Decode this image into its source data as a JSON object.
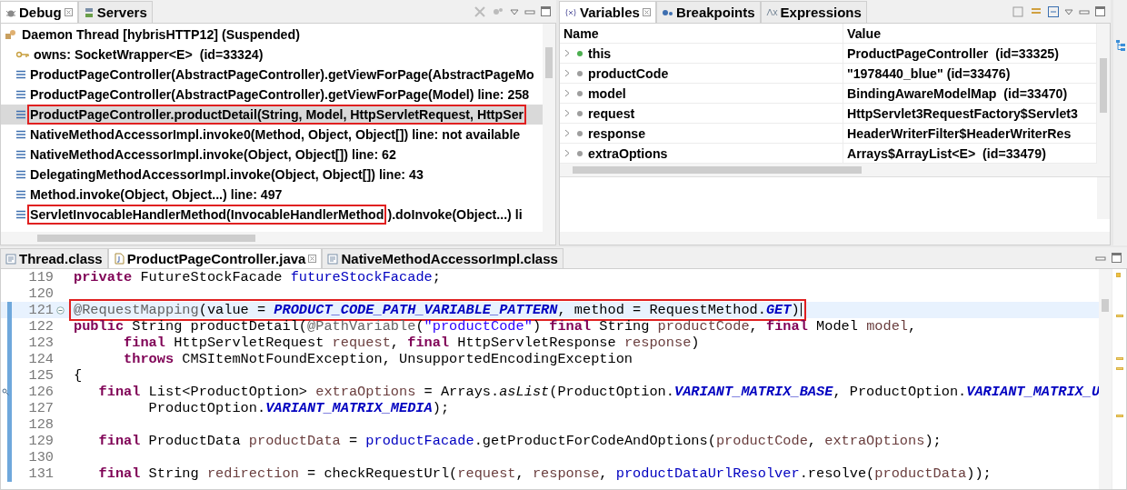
{
  "debug_view": {
    "tabs": [
      {
        "label": "Debug",
        "kind": "debug",
        "selected": true
      },
      {
        "label": "Servers",
        "kind": "servers",
        "selected": false
      }
    ],
    "thread": {
      "label": "Daemon Thread [hybrisHTTP12] (Suspended)",
      "kind": "thread",
      "children": [
        {
          "kind": "monitor",
          "text": "owns: SocketWrapper<E>  (id=33324)",
          "selected": false
        },
        {
          "kind": "frame",
          "text": "ProductPageController(AbstractPageController).getViewForPage(AbstractPageMo",
          "selected": false
        },
        {
          "kind": "frame",
          "text": "ProductPageController(AbstractPageController).getViewForPage(Model) line: 258",
          "selected": false
        },
        {
          "kind": "frame",
          "text": "ProductPageController.productDetail(String, Model, HttpServletRequest, HttpSer",
          "selected": true,
          "outlined": true
        },
        {
          "kind": "frame",
          "text": "NativeMethodAccessorImpl.invoke0(Method, Object, Object[]) line: not available",
          "selected": false
        },
        {
          "kind": "frame",
          "text": "NativeMethodAccessorImpl.invoke(Object, Object[]) line: 62",
          "selected": false
        },
        {
          "kind": "frame",
          "text": "DelegatingMethodAccessorImpl.invoke(Object, Object[]) line: 43",
          "selected": false
        },
        {
          "kind": "frame",
          "text": "Method.invoke(Object, Object...) line: 497",
          "selected": false
        },
        {
          "kind": "frame",
          "text": "ServletInvocableHandlerMethod(InvocableHandlerMethod",
          "continuation": ").doInvoke(Object...) li",
          "selected": false,
          "outlined": true
        }
      ]
    }
  },
  "variables_view": {
    "tabs": [
      {
        "label": "Variables",
        "kind": "variables",
        "selected": true
      },
      {
        "label": "Breakpoints",
        "kind": "breakpoints",
        "selected": false
      },
      {
        "label": "Expressions",
        "kind": "expressions",
        "selected": false
      }
    ],
    "columns": [
      "Name",
      "Value"
    ],
    "rows": [
      {
        "name": "this",
        "value": "ProductPageController  (id=33325)",
        "color": "#4caf50",
        "expanded": false
      },
      {
        "name": "productCode",
        "value": "\"1978440_blue\" (id=33476)",
        "color": "#9e9e9e",
        "expanded": false
      },
      {
        "name": "model",
        "value": "BindingAwareModelMap  (id=33470)",
        "color": "#9e9e9e",
        "expanded": false
      },
      {
        "name": "request",
        "value": "HttpServlet3RequestFactory$Servlet3",
        "color": "#9e9e9e",
        "expanded": false
      },
      {
        "name": "response",
        "value": "HeaderWriterFilter$HeaderWriterRes",
        "color": "#9e9e9e",
        "expanded": false
      },
      {
        "name": "extraOptions",
        "value": "Arrays$ArrayList<E>  (id=33479)",
        "color": "#9e9e9e",
        "expanded": false
      }
    ]
  },
  "editor": {
    "tabs": [
      {
        "label": "Thread.class",
        "kind": "class",
        "selected": false
      },
      {
        "label": "ProductPageController.java",
        "kind": "java",
        "selected": true
      },
      {
        "label": "NativeMethodAccessorImpl.class",
        "kind": "class",
        "selected": false
      }
    ],
    "lines": [
      {
        "number": "119",
        "tokens": [
          {
            "kind": "kw",
            "text": "private"
          },
          {
            "kind": "plain",
            "text": " FutureStockFacade "
          },
          {
            "kind": "field",
            "text": "futureStockFacade"
          },
          {
            "kind": "plain",
            "text": ";"
          }
        ]
      },
      {
        "number": "120"
      },
      {
        "number": "121",
        "in_range": true,
        "current": true,
        "outlined": true,
        "foldable": true,
        "caret": true,
        "tokens": [
          {
            "kind": "annot",
            "text": "@RequestMapping"
          },
          {
            "kind": "plain",
            "text": "(value = "
          },
          {
            "kind": "const",
            "text": "PRODUCT_CODE_PATH_VARIABLE_PATTERN"
          },
          {
            "kind": "plain",
            "text": ", method = RequestMethod."
          },
          {
            "kind": "const",
            "text": "GET"
          },
          {
            "kind": "plain",
            "text": ")"
          }
        ]
      },
      {
        "number": "122",
        "in_range": true,
        "tokens": [
          {
            "kind": "kw",
            "text": "public"
          },
          {
            "kind": "plain",
            "text": " String productDetail("
          },
          {
            "kind": "annot",
            "text": "@PathVariable"
          },
          {
            "kind": "plain",
            "text": "("
          },
          {
            "kind": "str",
            "text": "\"productCode\""
          },
          {
            "kind": "plain",
            "text": ") "
          },
          {
            "kind": "kw",
            "text": "final"
          },
          {
            "kind": "plain",
            "text": " String "
          },
          {
            "kind": "local",
            "text": "productCode"
          },
          {
            "kind": "plain",
            "text": ", "
          },
          {
            "kind": "kw",
            "text": "final"
          },
          {
            "kind": "plain",
            "text": " Model "
          },
          {
            "kind": "local",
            "text": "model"
          },
          {
            "kind": "plain",
            "text": ","
          }
        ]
      },
      {
        "number": "123",
        "in_range": true,
        "tokens": [
          {
            "kind": "kw",
            "text": "      final"
          },
          {
            "kind": "plain",
            "text": " HttpServletRequest "
          },
          {
            "kind": "local",
            "text": "request"
          },
          {
            "kind": "plain",
            "text": ", "
          },
          {
            "kind": "kw",
            "text": "final"
          },
          {
            "kind": "plain",
            "text": " HttpServletResponse "
          },
          {
            "kind": "local",
            "text": "response"
          },
          {
            "kind": "plain",
            "text": ")"
          }
        ]
      },
      {
        "number": "124",
        "in_range": true,
        "tokens": [
          {
            "kind": "kw",
            "text": "      throws"
          },
          {
            "kind": "plain",
            "text": " CMSItemNotFoundException, UnsupportedEncodingException"
          }
        ]
      },
      {
        "number": "125",
        "in_range": true,
        "tokens": [
          {
            "kind": "plain",
            "text": "{"
          }
        ]
      },
      {
        "number": "126",
        "in_range": true,
        "marker": true,
        "tokens": [
          {
            "kind": "kw",
            "text": "   final"
          },
          {
            "kind": "plain",
            "text": " List<ProductOption> "
          },
          {
            "kind": "local",
            "text": "extraOptions"
          },
          {
            "kind": "plain",
            "text": " = Arrays."
          },
          {
            "kind": "static",
            "text": "asList"
          },
          {
            "kind": "plain",
            "text": "(ProductOption."
          },
          {
            "kind": "const",
            "text": "VARIANT_MATRIX_BASE"
          },
          {
            "kind": "plain",
            "text": ", ProductOption."
          },
          {
            "kind": "const",
            "text": "VARIANT_MATRIX_U"
          }
        ]
      },
      {
        "number": "127",
        "in_range": true,
        "tokens": [
          {
            "kind": "plain",
            "text": "         ProductOption."
          },
          {
            "kind": "const",
            "text": "VARIANT_MATRIX_MEDIA"
          },
          {
            "kind": "plain",
            "text": ");"
          }
        ]
      },
      {
        "number": "128",
        "in_range": true
      },
      {
        "number": "129",
        "in_range": true,
        "tokens": [
          {
            "kind": "kw",
            "text": "   final"
          },
          {
            "kind": "plain",
            "text": " ProductData "
          },
          {
            "kind": "local",
            "text": "productData"
          },
          {
            "kind": "plain",
            "text": " = "
          },
          {
            "kind": "field",
            "text": "productFacade"
          },
          {
            "kind": "plain",
            "text": ".getProductForCodeAndOptions("
          },
          {
            "kind": "local",
            "text": "productCode"
          },
          {
            "kind": "plain",
            "text": ", "
          },
          {
            "kind": "local",
            "text": "extraOptions"
          },
          {
            "kind": "plain",
            "text": ");"
          }
        ]
      },
      {
        "number": "130",
        "in_range": true
      },
      {
        "number": "131",
        "in_range": true,
        "tokens": [
          {
            "kind": "kw",
            "text": "   final"
          },
          {
            "kind": "plain",
            "text": " String "
          },
          {
            "kind": "local",
            "text": "redirection"
          },
          {
            "kind": "plain",
            "text": " = checkRequestUrl("
          },
          {
            "kind": "local",
            "text": "request"
          },
          {
            "kind": "plain",
            "text": ", "
          },
          {
            "kind": "local",
            "text": "response"
          },
          {
            "kind": "plain",
            "text": ", "
          },
          {
            "kind": "field",
            "text": "productDataUrlResolver"
          },
          {
            "kind": "plain",
            "text": ".resolve("
          },
          {
            "kind": "local",
            "text": "productData"
          },
          {
            "kind": "plain",
            "text": "));"
          }
        ]
      }
    ]
  }
}
